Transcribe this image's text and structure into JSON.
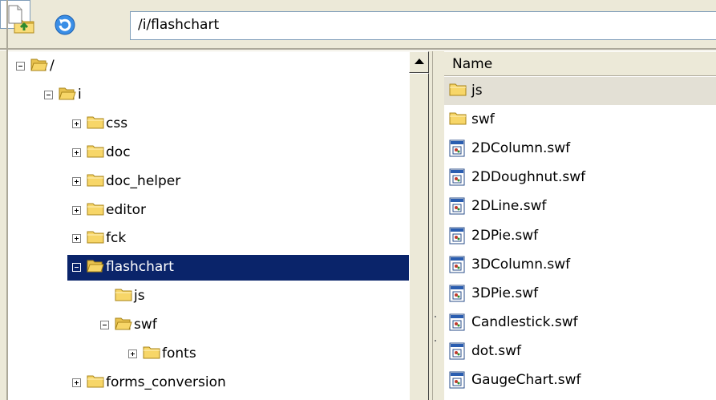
{
  "toolbar": {
    "up_icon": "folder-up-icon",
    "refresh_icon": "refresh-icon",
    "page_icon": "page-icon",
    "path": "/i/flashchart"
  },
  "tree": {
    "items": [
      {
        "label": "/",
        "depth": 0,
        "expander": "minus",
        "open": true
      },
      {
        "label": "i",
        "depth": 1,
        "expander": "minus",
        "open": true
      },
      {
        "label": "css",
        "depth": 2,
        "expander": "plus",
        "open": false
      },
      {
        "label": "doc",
        "depth": 2,
        "expander": "plus",
        "open": false
      },
      {
        "label": "doc_helper",
        "depth": 2,
        "expander": "plus",
        "open": false
      },
      {
        "label": "editor",
        "depth": 2,
        "expander": "plus",
        "open": false
      },
      {
        "label": "fck",
        "depth": 2,
        "expander": "plus",
        "open": false
      },
      {
        "label": "flashchart",
        "depth": 2,
        "expander": "minus",
        "open": true,
        "selected": true
      },
      {
        "label": "js",
        "depth": 3,
        "expander": "none",
        "open": false
      },
      {
        "label": "swf",
        "depth": 3,
        "expander": "minus",
        "open": true
      },
      {
        "label": "fonts",
        "depth": 4,
        "expander": "plus",
        "open": false
      },
      {
        "label": "forms_conversion",
        "depth": 2,
        "expander": "plus",
        "open": false
      }
    ]
  },
  "list": {
    "column_name": "Name",
    "items": [
      {
        "label": "js",
        "type": "folder",
        "hot": true
      },
      {
        "label": "swf",
        "type": "folder"
      },
      {
        "label": "2DColumn.swf",
        "type": "file"
      },
      {
        "label": "2DDoughnut.swf",
        "type": "file"
      },
      {
        "label": "2DLine.swf",
        "type": "file"
      },
      {
        "label": "2DPie.swf",
        "type": "file"
      },
      {
        "label": "3DColumn.swf",
        "type": "file"
      },
      {
        "label": "3DPie.swf",
        "type": "file"
      },
      {
        "label": "Candlestick.swf",
        "type": "file"
      },
      {
        "label": "dot.swf",
        "type": "file"
      },
      {
        "label": "GaugeChart.swf",
        "type": "file"
      }
    ]
  },
  "colors": {
    "selection": "#0a246a",
    "folder": "#f7d668",
    "chrome": "#ece9d8"
  }
}
